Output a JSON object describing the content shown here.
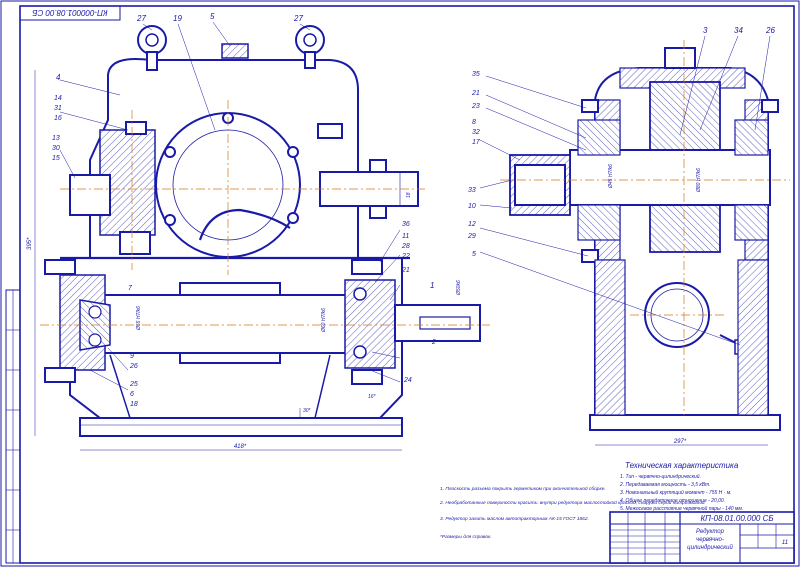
{
  "title_block": {
    "code_rot": "КП-000001.08.00 СБ",
    "document_code": "КП-08.01.00.000 СБ",
    "product_name_line1": "Редуктор",
    "product_name_line2": "червячно-",
    "product_name_line3": "цилиндрический",
    "sheets": "11"
  },
  "tech_char": {
    "heading": "Техническая характеристика",
    "items": [
      "1. Тип - червячно-цилиндрический.",
      "2. Передаваемая мощность - 3,5 кВт.",
      "3. Номинальный крутящий момент - 755 Н · м.",
      "4. Общее передаточное отношение - 20,00.",
      "5. Межосевое расстояние червячной пары - 140 мм."
    ]
  },
  "notes": {
    "items": [
      "1. Плоскость разъема покрыть герметиком при окончательной сборке.",
      "2. Необработанные поверхности красить: внутри редуктора маслостойкой краской, снаружи серой нитроэмалью.",
      "3. Редуктор залить маслом автотракторным АК-15 ГОСТ 1862."
    ],
    "footer": "*Размеры для справок."
  },
  "part_labels_front": [
    "27",
    "19",
    "5",
    "27",
    "4",
    "14",
    "31",
    "16",
    "13",
    "30",
    "15",
    "36",
    "11",
    "28",
    "22",
    "21",
    "1",
    "7",
    "9",
    "26",
    "25",
    "6",
    "18",
    "2",
    "24"
  ],
  "part_labels_side": [
    "3",
    "34",
    "26",
    "35",
    "21",
    "23",
    "8",
    "32",
    "17",
    "33",
    "10",
    "12",
    "29",
    "5"
  ],
  "dimensions": {
    "overall_length": "418*",
    "overall_height": "395*",
    "side_width": "297*",
    "base_h1": "30*",
    "base_h2": "16*",
    "shaft_d": "Ø50k6",
    "fit1": "Ø55 H7/k6",
    "fit2": "Ø60 H7/k6",
    "fit3": "Ø45 H7/k6",
    "fit4": "Ø80 H7/k6",
    "key": "18"
  }
}
